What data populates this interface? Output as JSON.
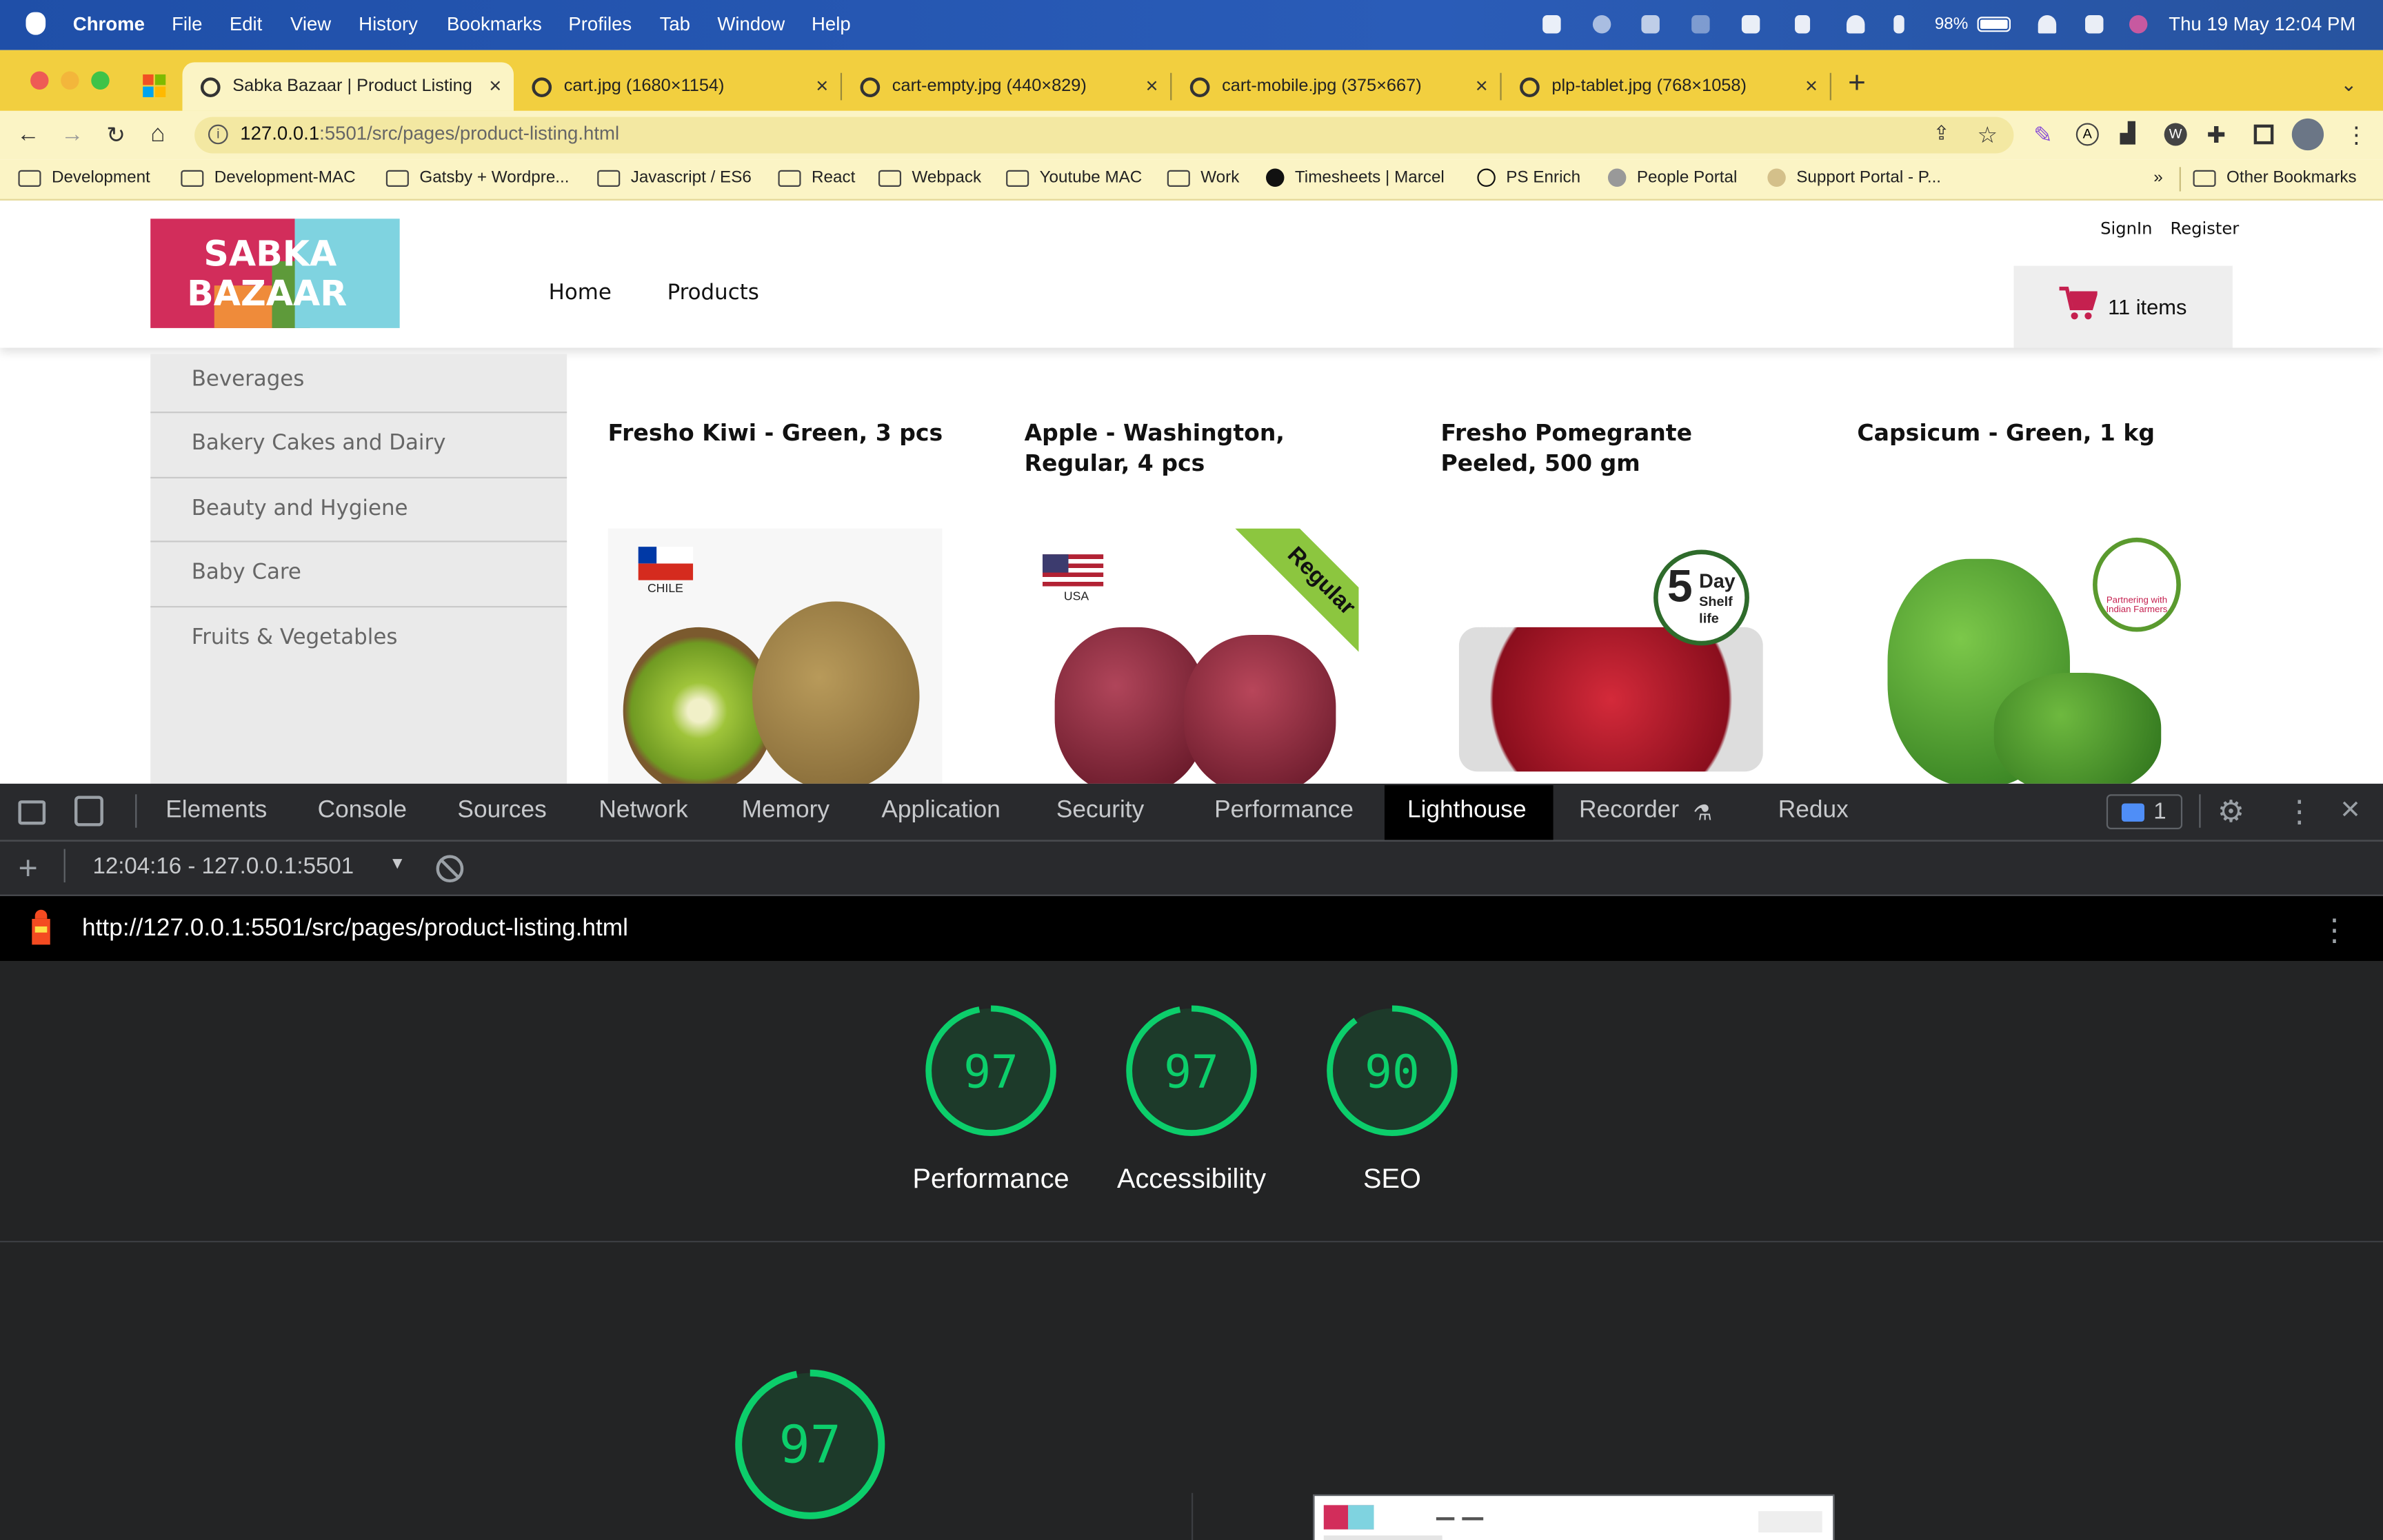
{
  "menubar": {
    "app": "Chrome",
    "items": [
      "File",
      "Edit",
      "View",
      "History",
      "Bookmarks",
      "Profiles",
      "Tab",
      "Window",
      "Help"
    ],
    "battery": "98%",
    "clock": "Thu 19 May  12:04 PM"
  },
  "tabs": [
    {
      "title": "Sabka Bazaar | Product Listing",
      "active": true
    },
    {
      "title": "cart.jpg (1680×1154)",
      "active": false
    },
    {
      "title": "cart-empty.jpg (440×829)",
      "active": false
    },
    {
      "title": "cart-mobile.jpg (375×667)",
      "active": false
    },
    {
      "title": "plp-tablet.jpg (768×1058)",
      "active": false
    }
  ],
  "toolbar": {
    "url_host": "127.0.0.1",
    "url_path": ":5501/src/pages/product-listing.html"
  },
  "bookmarks": [
    "Development",
    "Development-MAC",
    "Gatsby + Wordpre...",
    "Javascript / ES6",
    "React",
    "Webpack",
    "Youtube MAC",
    "Work",
    "Timesheets | Marcel",
    "PS Enrich",
    "People Portal",
    "Support Portal - P..."
  ],
  "bookmarks_overflow": "»",
  "other_bookmarks": "Other Bookmarks",
  "site": {
    "logo_lines": [
      "SABKA",
      "BAZAAR"
    ],
    "nav": [
      "Home",
      "Products"
    ],
    "auth": {
      "signin": "SignIn",
      "register": "Register"
    },
    "cart_label": "11 items",
    "categories": [
      "Beverages",
      "Bakery Cakes and Dairy",
      "Beauty and Hygiene",
      "Baby Care",
      "Fruits & Vegetables"
    ],
    "products": [
      {
        "name": "Fresho Kiwi - Green, 3 pcs",
        "badge": "CHILE"
      },
      {
        "name": "Apple - Washington, Regular, 4 pcs",
        "badge": "USA",
        "ribbon": "Regular"
      },
      {
        "name": "Fresho Pomegrante Peeled, 500 gm",
        "badge_top": "Day",
        "badge_mid": "Shelf",
        "badge_bot": "life",
        "badge_num": "5"
      },
      {
        "name": "Capsicum - Green, 1 kg",
        "badge": "Partnering with Indian Farmers"
      }
    ]
  },
  "devtools": {
    "tabs": [
      "Elements",
      "Console",
      "Sources",
      "Network",
      "Memory",
      "Application",
      "Security",
      "Performance",
      "Lighthouse",
      "Recorder",
      "Redux"
    ],
    "active_tab": "Lighthouse",
    "issues_count": "1",
    "report_selector": "12:04:16 - 127.0.0.1:5501",
    "report_url": "http://127.0.0.1:5501/src/pages/product-listing.html",
    "scores": [
      {
        "label": "Performance",
        "value": 97
      },
      {
        "label": "Accessibility",
        "value": 97
      },
      {
        "label": "SEO",
        "value": 90
      }
    ],
    "big_score": 97,
    "colors": {
      "pass": "#0cce6b",
      "gauge_bg": "#1d3a2a"
    }
  }
}
